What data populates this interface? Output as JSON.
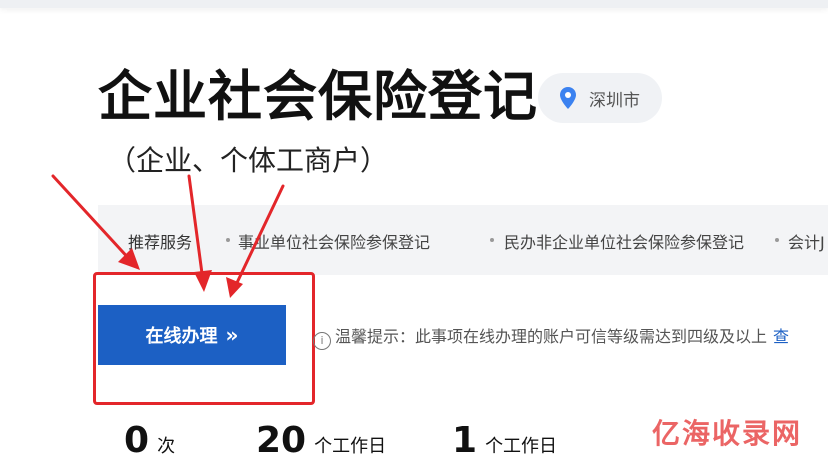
{
  "page": {
    "title": "企业社会保险登记",
    "subtitle": "（企业、个体工商户）",
    "location": {
      "icon": "location-pin-icon",
      "label": "深圳市"
    }
  },
  "services": {
    "label": "推荐服务",
    "items": [
      "事业单位社会保险参保登记",
      "民办非企业单位社会保险参保登记",
      "会计J"
    ]
  },
  "actions": {
    "online_button": "在线办理",
    "online_button_chevron": "»"
  },
  "tip": {
    "icon": "info-icon",
    "text": "温馨提示：此事项在线办理的账户可信等级需达到四级及以上",
    "link": "查"
  },
  "stats": [
    {
      "value": "0",
      "unit": "次"
    },
    {
      "value": "20",
      "unit": "个工作日"
    },
    {
      "value": "1",
      "unit": "个工作日"
    }
  ],
  "watermark": "亿海收录网",
  "colors": {
    "primary": "#1c60c4",
    "annotation_red": "#e3262a"
  }
}
